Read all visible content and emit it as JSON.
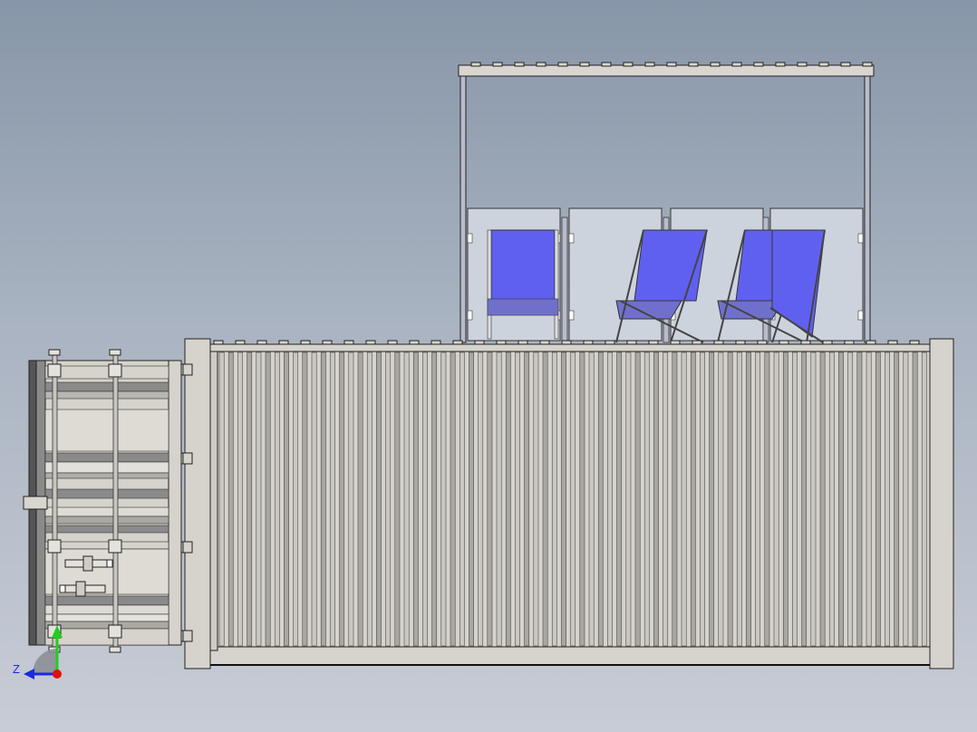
{
  "viewport": {
    "background_top": "#8796a8",
    "background_bottom": "#c8ccd6"
  },
  "model": {
    "container_color": "#d6d3cc",
    "corrugation_light": "#c9c7c0",
    "corrugation_dark": "#a9a7a0",
    "panel_color": "#cdd3dc",
    "chair_fabric": "#6060f0",
    "frame_color": "#b9bccb",
    "chair_count": 4,
    "door_bar_count": 2
  },
  "triad": {
    "z_label": "Z",
    "y_color": "#1ecf1e",
    "z_color": "#1a2ae0",
    "origin_color": "#e01010"
  }
}
